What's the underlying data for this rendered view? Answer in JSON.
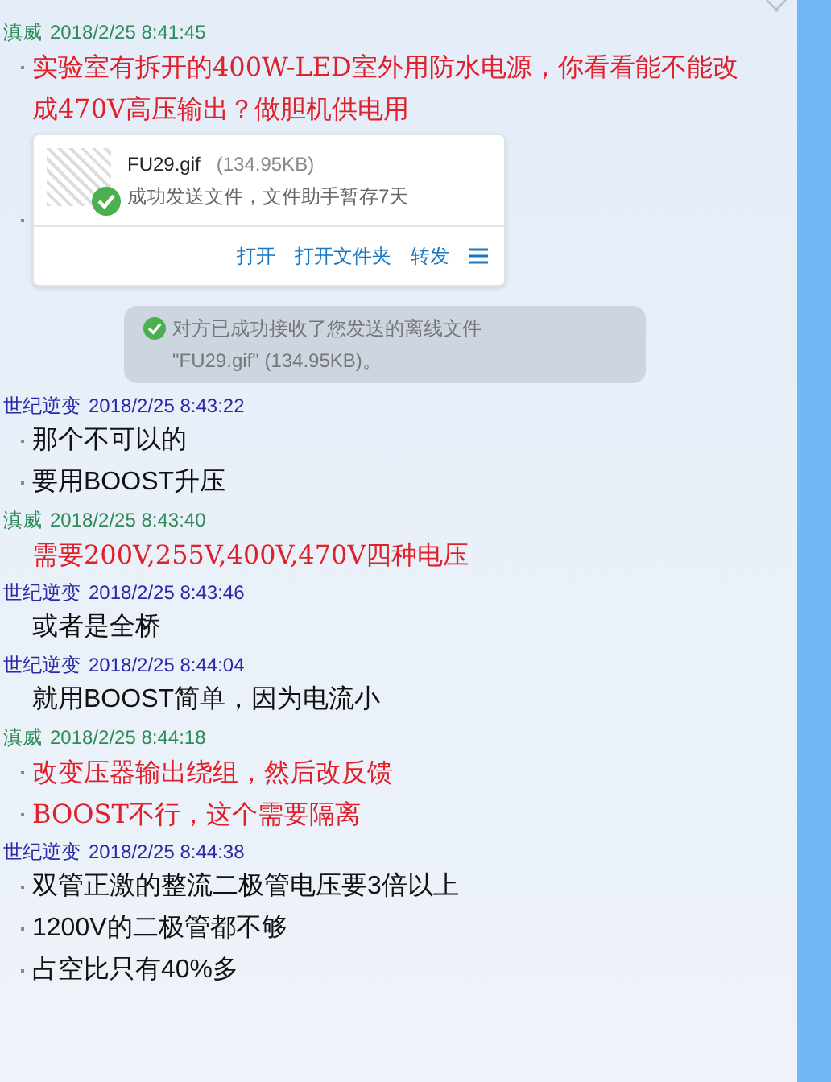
{
  "chat": [
    {
      "kind": "header",
      "sender": "滇威",
      "time": "2018/2/25 8:41:45",
      "color": "#2e8b57"
    },
    {
      "kind": "highlight",
      "bullet": true,
      "text": "实验室有拆开的400W-LED室外用防水电源，你看看能不能改成470V高压输出？做胆机供电用"
    },
    {
      "kind": "file",
      "bullet": true,
      "file_name": "FU29.gif",
      "size": "(134.95KB)",
      "status": "成功发送文件，文件助手暂存7天",
      "actions": [
        "打开",
        "打开文件夹",
        "转发"
      ]
    },
    {
      "kind": "notice",
      "line1": "对方已成功接收了您发送的离线文件",
      "line2": "\"FU29.gif\"  (134.95KB)。"
    },
    {
      "kind": "header",
      "sender": "世纪逆变",
      "time": "2018/2/25 8:43:22",
      "color": "#2a2aa8"
    },
    {
      "kind": "text",
      "bullet": true,
      "text": "那个不可以的"
    },
    {
      "kind": "text",
      "bullet": true,
      "text": "要用BOOST升压"
    },
    {
      "kind": "header",
      "sender": "滇威",
      "time": "2018/2/25 8:43:40",
      "color": "#2e8b57"
    },
    {
      "kind": "highlight",
      "bullet": false,
      "text": "需要200V,255V,400V,470V四种电压"
    },
    {
      "kind": "header",
      "sender": "世纪逆变",
      "time": "2018/2/25 8:43:46",
      "color": "#2a2aa8"
    },
    {
      "kind": "text",
      "bullet": false,
      "text": "或者是全桥"
    },
    {
      "kind": "header",
      "sender": "世纪逆变",
      "time": "2018/2/25 8:44:04",
      "color": "#2a2aa8"
    },
    {
      "kind": "text",
      "bullet": false,
      "text": "就用BOOST简单，因为电流小"
    },
    {
      "kind": "header",
      "sender": "滇威",
      "time": "2018/2/25 8:44:18",
      "color": "#2e8b57"
    },
    {
      "kind": "highlight",
      "bullet": true,
      "text": "改变压器输出绕组，然后改反馈"
    },
    {
      "kind": "highlight",
      "bullet": true,
      "text": "BOOST不行，这个需要隔离"
    },
    {
      "kind": "header",
      "sender": "世纪逆变",
      "time": "2018/2/25 8:44:38",
      "color": "#2a2aa8"
    },
    {
      "kind": "text",
      "bullet": true,
      "text": "双管正激的整流二极管电压要3倍以上"
    },
    {
      "kind": "text",
      "bullet": true,
      "text": "1200V的二极管都不够"
    },
    {
      "kind": "text",
      "bullet": true,
      "text": "占空比只有40%多"
    }
  ]
}
